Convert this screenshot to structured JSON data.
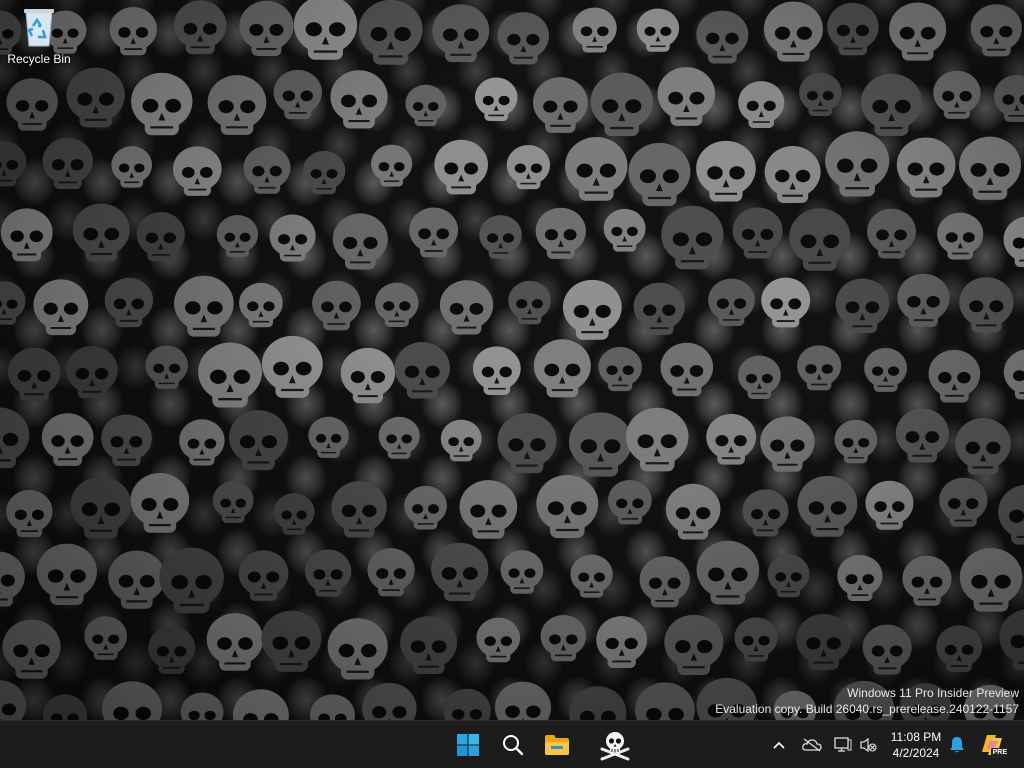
{
  "desktop": {
    "icons": [
      {
        "label": "Recycle Bin"
      }
    ],
    "watermark": {
      "line1": "Windows 11 Pro Insider Preview",
      "line2": "Evaluation copy. Build 26040.rs_prerelease.240122-1157"
    }
  },
  "taskbar": {
    "pinned": [
      {
        "name": "start-button",
        "icon": "windows-logo-icon"
      },
      {
        "name": "search-button",
        "icon": "search-icon"
      },
      {
        "name": "file-explorer-button",
        "icon": "folder-icon"
      },
      {
        "name": "skull-app-button",
        "icon": "skull-crossbones-icon"
      }
    ],
    "tray": {
      "icons": [
        "chevron-up-icon",
        "onedrive-icon",
        "network-icon",
        "volume-muted-icon",
        "notification-bell-icon",
        "copilot-pre-icon"
      ],
      "time": "11:08 PM",
      "date": "4/2/2024",
      "copilot_badge": "PRE"
    }
  },
  "colors": {
    "taskbar_bg": "#1c1c1c",
    "accent_blue": "#29a8e0",
    "folder_yellow": "#f7c645"
  }
}
